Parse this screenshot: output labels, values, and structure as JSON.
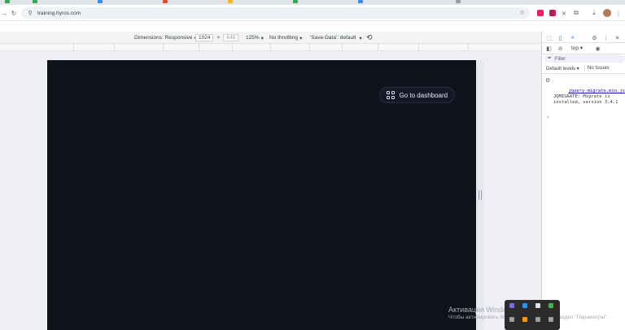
{
  "browser": {
    "url": "training.hyros.com",
    "nav": {
      "back_icon": "arrow-left-icon",
      "reload_icon": "reload-icon"
    },
    "tab_colors": [
      "#34a853",
      "#34a853",
      "#4285f4",
      "#ea4335",
      "#fbbc04",
      "#34a853",
      "#4285f4",
      "#9aa0a6"
    ],
    "extension_colors": [
      "#e91e63",
      "#c2185b",
      "#5f6368",
      "#5f6368"
    ]
  },
  "device_toolbar": {
    "dimensions_label": "Dimensions: Responsive",
    "width": "1024",
    "separator": "×",
    "height": "648",
    "zoom": "125%",
    "throttling": "No throttling",
    "save_data": "'Save-Data': default",
    "rotate_icon": "rotate-icon"
  },
  "page": {
    "background": "#0f111b",
    "dashboard_button": "Go to dashboard"
  },
  "devtools": {
    "context": "top",
    "filter_placeholder": "Filter",
    "levels": "Default levels",
    "issues": "No Issues",
    "console": {
      "source": "jquery-migrate.min.js",
      "message": "JQMIGRATE: Migrate is installed, version 3.4.1"
    },
    "prompt": "›"
  },
  "watermark": {
    "line1": "Активация Windows",
    "line2": "Чтобы активировать Windows, перейдите в раздел \"Параметры\"."
  },
  "tray": {
    "icon_colors": [
      "#7b68ee",
      "#2196f3",
      "#e0e0e0",
      "#4caf50",
      "#9e9e9e",
      "#ff9800",
      "#9e9e9e",
      "#9e9e9e"
    ]
  }
}
